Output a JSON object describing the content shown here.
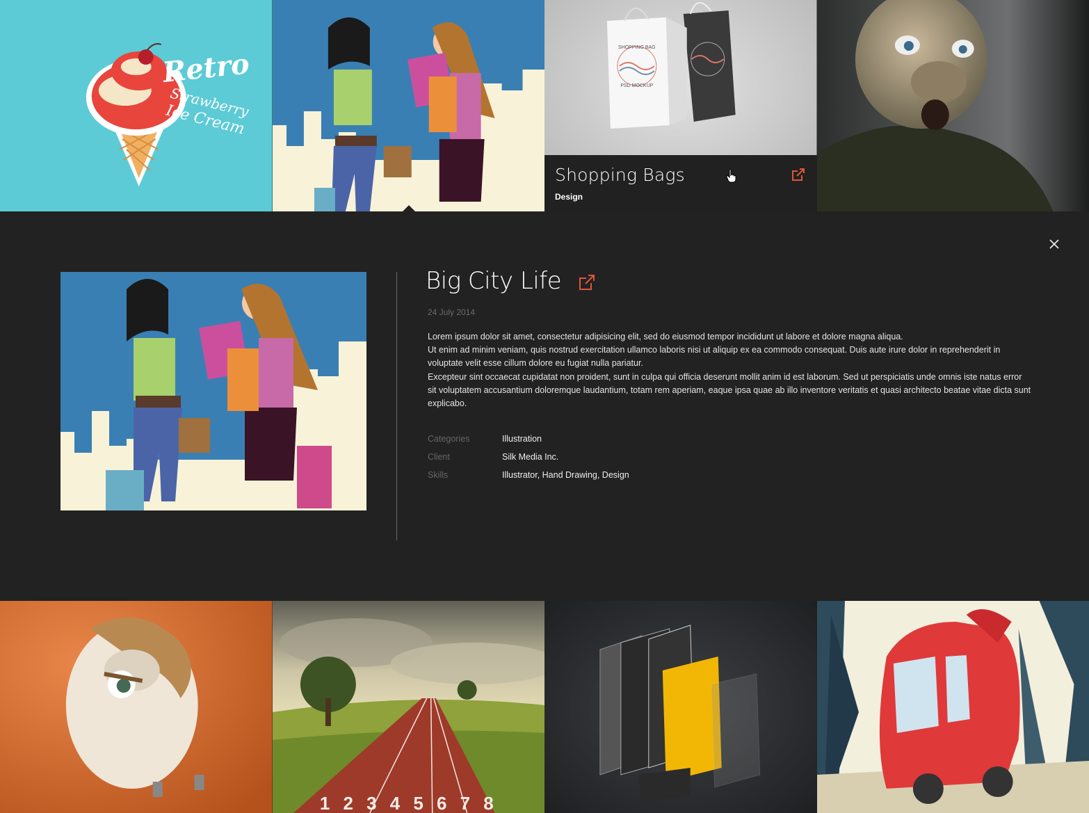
{
  "hover_item": {
    "title": "Shopping Bags",
    "category": "Design"
  },
  "detail": {
    "title": "Big City Life",
    "date": "24 July 2014",
    "paragraphs": [
      "Lorem ipsum dolor sit amet, consectetur adipisicing elit, sed do eiusmod tempor incididunt ut labore et dolore magna aliqua.",
      "Ut enim ad minim veniam, quis nostrud exercitation ullamco laboris nisi ut aliquip ex ea commodo consequat. Duis aute irure dolor in reprehenderit in voluptate velit esse cillum dolore eu fugiat nulla pariatur.",
      "Excepteur sint occaecat cupidatat non proident, sunt in culpa qui officia deserunt mollit anim id est laborum. Sed ut perspiciatis unde omnis iste natus error sit voluptatem accusantium doloremque laudantium, totam rem aperiam, eaque ipsa quae ab illo inventore veritatis et quasi architecto beatae vitae dicta sunt explicabo."
    ],
    "meta": [
      {
        "label": "Categories",
        "value": "Illustration"
      },
      {
        "label": "Client",
        "value": "Silk Media Inc."
      },
      {
        "label": "Skills",
        "value": "Illustrator, Hand Drawing, Design"
      }
    ]
  },
  "tile_art": {
    "retro": {
      "line1": "Retro",
      "line2": "Strawberry",
      "line3": "Ice Cream"
    },
    "bag": {
      "text1": "SHOPPING BAG",
      "text2": "PSD MOCKUP"
    },
    "track_numbers": "1 2 3 4 5 6 7 8"
  },
  "icons": {
    "external_link": "external-link-icon",
    "close": "close-icon",
    "cursor": "hand-cursor-icon"
  },
  "colors": {
    "accent": "#e0553a",
    "panel_bg": "#222222",
    "text_muted": "#6b6b6b"
  }
}
